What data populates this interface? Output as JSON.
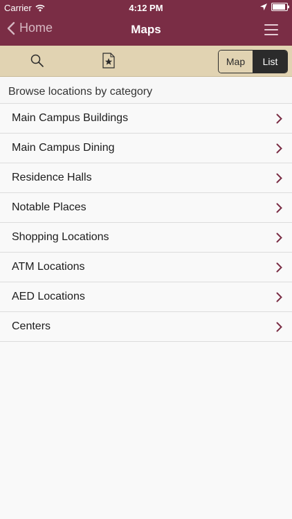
{
  "status_bar": {
    "carrier": "Carrier",
    "time": "4:12 PM",
    "wifi_icon": "wifi-icon",
    "location_icon": "location-arrow-icon",
    "battery_icon": "battery-icon"
  },
  "nav": {
    "back_label": "Home",
    "title": "Maps",
    "menu_icon": "hamburger-menu-icon"
  },
  "toolbar": {
    "search_icon": "search-icon",
    "favorites_icon": "star-bookmark-icon",
    "segments": [
      {
        "label": "Map",
        "selected": false
      },
      {
        "label": "List",
        "selected": true
      }
    ]
  },
  "section": {
    "title": "Browse locations by category"
  },
  "categories": [
    {
      "label": "Main Campus Buildings"
    },
    {
      "label": "Main Campus Dining"
    },
    {
      "label": "Residence Halls"
    },
    {
      "label": "Notable Places"
    },
    {
      "label": "Shopping Locations"
    },
    {
      "label": "ATM Locations"
    },
    {
      "label": "AED Locations"
    },
    {
      "label": "Centers"
    }
  ],
  "colors": {
    "brand": "#7a2d45",
    "toolbar": "#e1d3b2",
    "chevron": "#7a2d45"
  }
}
